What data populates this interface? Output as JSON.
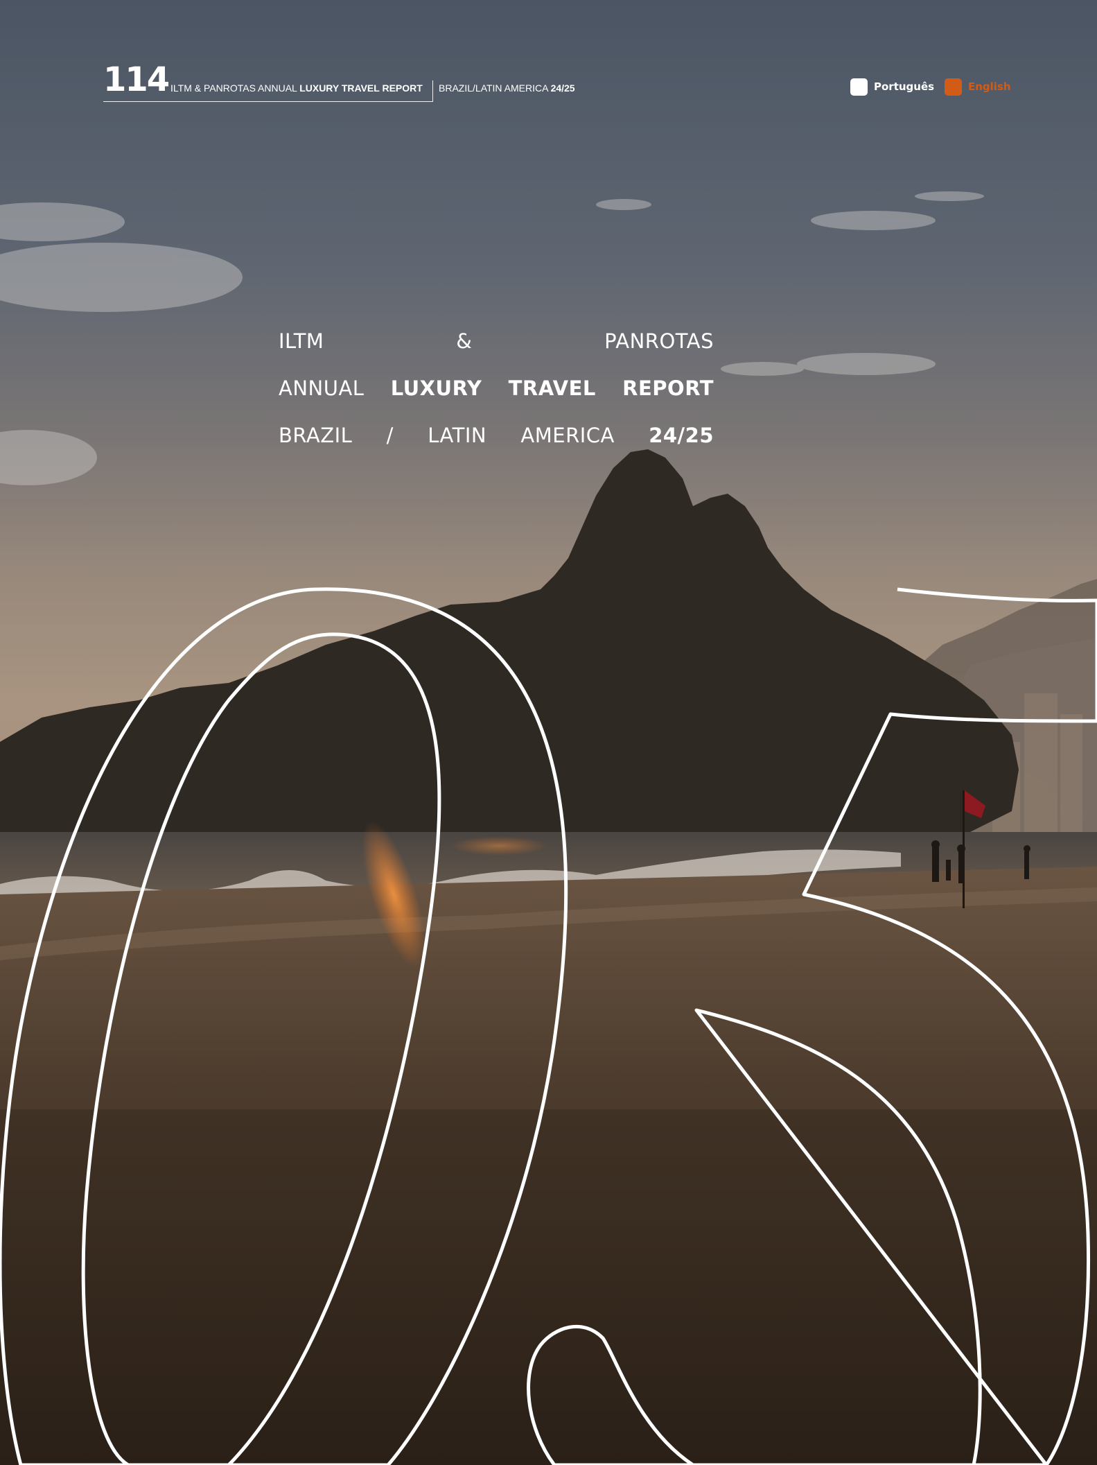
{
  "header": {
    "page_number": "114",
    "report_prefix": "ILTM & PANROTAS ANNUAL",
    "report_bold": "LUXURY TRAVEL REPORT",
    "region": "BRAZIL/LATIN AMERICA",
    "edition": "24/25"
  },
  "languages": [
    {
      "label": "Português",
      "icon": "white-square-icon",
      "color": "#ffffff"
    },
    {
      "label": "English",
      "icon": "orange-square-icon",
      "color": "#d25c17",
      "active": true
    }
  ],
  "title": {
    "line1": [
      "ILTM",
      "&",
      "PANROTAS"
    ],
    "line2_regular": "ANNUAL",
    "line2_bold": [
      "LUXURY",
      "TRAVEL",
      "REPORT"
    ],
    "line3_regular": [
      "BRAZIL",
      "/",
      "LATIN",
      "AMERICA"
    ],
    "line3_bold": "24/25"
  },
  "chapter_numeral": "05",
  "colors": {
    "accent": "#d25c17",
    "text": "#ffffff"
  }
}
